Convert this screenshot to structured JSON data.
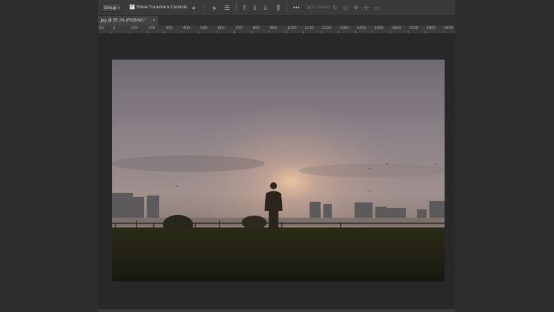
{
  "options_bar": {
    "auto_select_value": "Group",
    "show_transform_controls_label": "Show Transform Controls",
    "show_transform_controls_checked": true,
    "more_label": "•••",
    "mode_label": "3D Mode:",
    "icons": [
      "align-left-icon",
      "align-center-h-icon",
      "align-right-icon",
      "distribute-h-icon",
      "align-top-icon",
      "align-middle-v-icon",
      "align-bottom-icon",
      "distribute-v-icon",
      "more-options-icon",
      "3d-rotate-icon",
      "3d-roll-icon",
      "3d-pan-icon",
      "3d-slide-icon",
      "3d-scale-icon"
    ]
  },
  "document_tab": {
    "title": ".jpg @ 55.1% (RGB/8#) *",
    "close": "×"
  },
  "ruler": {
    "labels": [
      "00",
      "0",
      "100",
      "200",
      "300",
      "400",
      "500",
      "600",
      "700",
      "800",
      "900",
      "1000",
      "1100",
      "1200",
      "1300",
      "1400",
      "1500",
      "1600",
      "1700",
      "1800",
      "1900"
    ]
  },
  "canvas": {
    "image_description_name": "sunset-photo"
  },
  "colors": {
    "panel": "#3a3a3a",
    "workspace": "#282828",
    "outer": "#2d2d2d"
  }
}
